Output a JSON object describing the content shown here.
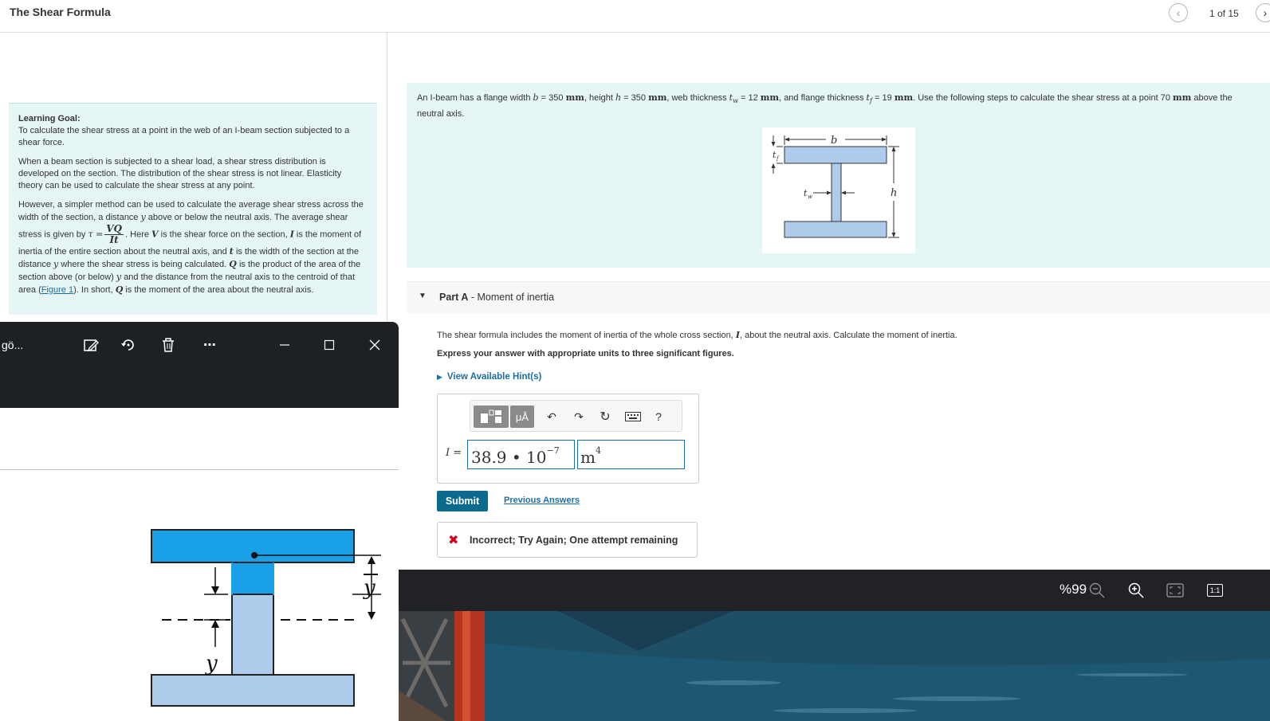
{
  "header": {
    "title": "The Shear Formula",
    "pager": "1 of 15"
  },
  "learning_goal": {
    "heading": "Learning Goal:",
    "goal": "To calculate the shear stress at a point in the web of an I-beam section subjected to a shear force.",
    "p1": "When a beam section is subjected to a shear load, a shear stress distribution is developed on the section. The distribution of the shear stress is not linear. Elasticity theory can be used to calculate the shear stress at any point.",
    "p2a": "However, a simpler method can be used to calculate the average shear stress across the width of the section, a distance",
    "p2b": "above or below the neutral axis. The average shear stress is given by",
    "p2c": ". Here",
    "p2d": "is the shear force on the section,",
    "p2e": "is the moment of inertia of the entire section about the neutral axis, and",
    "p2f": "is the width of the section at the distance",
    "p2g": "where the shear stress is being calculated.",
    "p2h": "is the product of the area of the section above (or below)",
    "p2i": "and the distance from the neutral axis to the centroid of that area (",
    "figure_link": "Figure 1",
    "p2j": "). In short,",
    "p2k": "is the moment of the area about the neutral axis.",
    "sym_y": "y",
    "sym_tau": "τ =",
    "sym_V": "V",
    "sym_I": "I",
    "sym_t": "t",
    "sym_Q": "Q",
    "frac_num": "VQ",
    "frac_den": "It"
  },
  "problem": {
    "t1": "An I-beam has a flange width",
    "b": "b",
    "eq": "=",
    "b_val": "350",
    "mm": "mm",
    "t2": ", height",
    "h": "h",
    "h_val": "350",
    "t3": ", web thickness",
    "tw": "t",
    "tw_sub": "w",
    "tw_val": "12",
    "t4": ", and flange thickness",
    "tf": "t",
    "tf_sub": "f",
    "tf_val": "19",
    "t5": ". Use the following steps to calculate the shear stress at a point 70",
    "t6": "above the neutral axis.",
    "fig_b": "b",
    "fig_tf": "t",
    "fig_tf_sub": "f",
    "fig_tw": "t",
    "fig_tw_sub": "w",
    "fig_h": "h"
  },
  "part_a": {
    "label": "Part A",
    "title": " - Moment of inertia",
    "desc_a": "The shear formula includes the moment of inertia of the whole cross section,",
    "desc_sym": "I",
    "desc_b": ", about the neutral axis. Calculate the moment of inertia.",
    "instruction": "Express your answer with appropriate units to three significant figures.",
    "hints": "View Available Hint(s)",
    "toolbar_mu": "μÅ",
    "toolbar_help": "?",
    "answer_label": "I =",
    "value_base": "38.9 • 10",
    "value_exp": "−7",
    "unit_base": "m",
    "unit_exp": "4",
    "submit": "Submit",
    "previous_answers": "Previous Answers",
    "feedback": "Incorrect; Try Again; One attempt remaining"
  },
  "photo_window": {
    "name": "gö...",
    "fig_y": "y",
    "fig_ybar": "y"
  },
  "viewer": {
    "zoom": "%99",
    "actual_size": "1:1"
  },
  "colors": {
    "accent": "#0c6b8c",
    "link": "#1a6fa8",
    "panel_bg": "#e6f6f6",
    "beam_fill": "#aecbeb",
    "beam_highlight": "#1aa0e6",
    "error": "#d0021b",
    "dark_chrome": "#1e2124"
  }
}
